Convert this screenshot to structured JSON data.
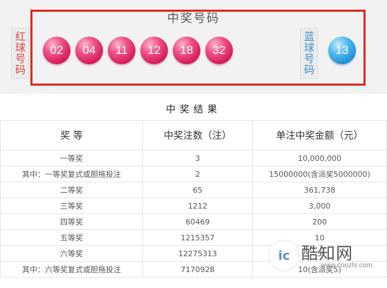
{
  "winning_numbers": {
    "title": "中奖号码",
    "red_label": "红球号码",
    "blue_label": "蓝球号码",
    "red_balls": [
      "02",
      "04",
      "11",
      "12",
      "18",
      "32"
    ],
    "blue_balls": [
      "13"
    ],
    "colors": {
      "frame": "#e0271f",
      "red_ball": "#e0306a",
      "blue_ball": "#2a9ae0"
    }
  },
  "results": {
    "title": "中奖结果",
    "headers": [
      "奖 等",
      "中奖注数（注）",
      "单注中奖金额（元）"
    ],
    "rows": [
      {
        "prize": "一等奖",
        "count": "3",
        "amount": "10,000,000"
      },
      {
        "prize": "其中：一等奖复式或胆拖投注",
        "count": "2",
        "amount": "15000000(含派奖5000000)"
      },
      {
        "prize": "二等奖",
        "count": "65",
        "amount": "361,738"
      },
      {
        "prize": "三等奖",
        "count": "1212",
        "amount": "3,000"
      },
      {
        "prize": "四等奖",
        "count": "60469",
        "amount": "200"
      },
      {
        "prize": "五等奖",
        "count": "1215357",
        "amount": "10"
      },
      {
        "prize": "六等奖",
        "count": "12275313",
        "amount": "5"
      },
      {
        "prize": "其中：六等奖复式或胆拖投注",
        "count": "7170928",
        "amount": "10(含派奖5)"
      }
    ]
  },
  "watermark": {
    "logo_text": "ic",
    "name": "酷知网",
    "url": "www.coozhi.com"
  }
}
